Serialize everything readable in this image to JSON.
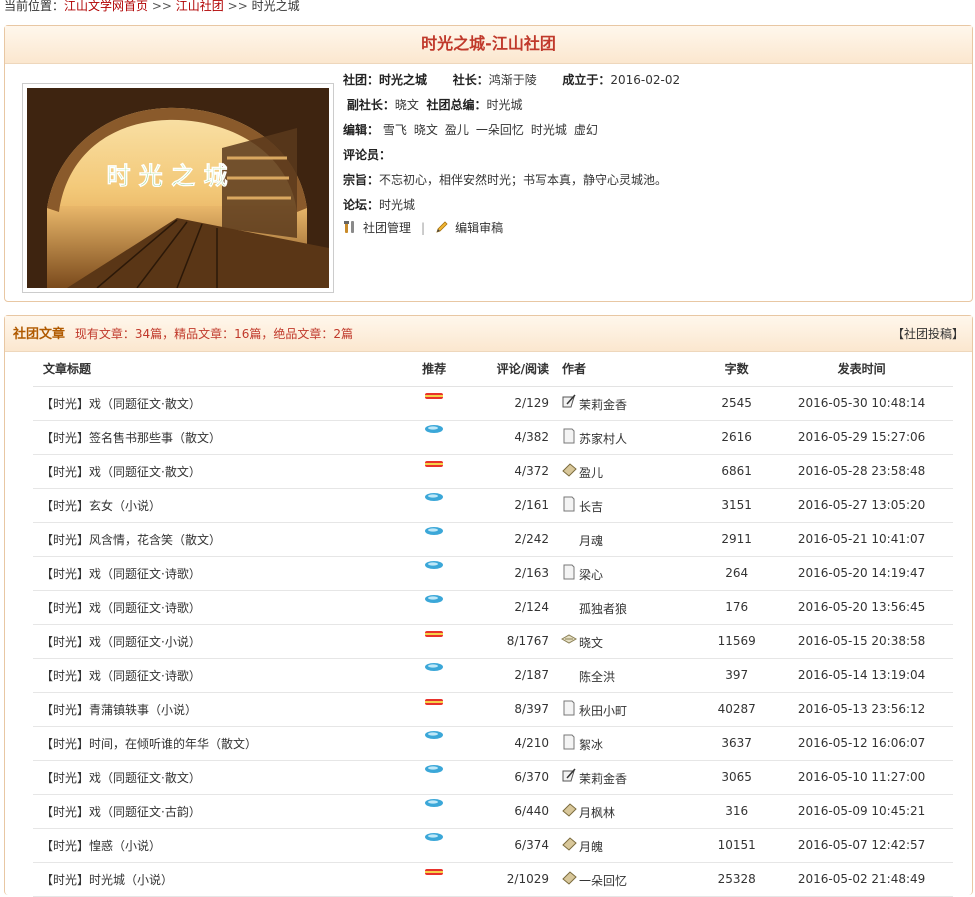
{
  "breadcrumb": {
    "prefix": "当前位置：",
    "home": "江山文学网首页",
    "sep": ">>",
    "section": "江山社团",
    "current": "时光之城"
  },
  "club": {
    "title": "时光之城-江山社团",
    "cover_text": "时 光 之 城",
    "club_label": "社团：",
    "club_name": "时光之城",
    "leader_label": "社长：",
    "leader": "鸿渐于陵",
    "founded_label": "成立于：",
    "founded": "2016-02-02",
    "vice_label": "副社长：",
    "vice": "晓文",
    "chief_label": "社团总编：",
    "chief": "时光城",
    "editors_label": "编辑：",
    "editors": [
      "雪飞",
      "晓文",
      "盈儿",
      "一朵回忆",
      "时光城",
      "虚幻"
    ],
    "reviewers_label": "评论员：",
    "motto_label": "宗旨：",
    "motto": "不忘初心，相伴安然时光；书写本真，静守心灵城池。",
    "forum_label": "论坛：",
    "forum": "时光城",
    "manage_label": "社团管理",
    "divider": "|",
    "review_label": "编辑审稿"
  },
  "articles": {
    "heading": "社团文章",
    "stats": "现有文章：34篇，精品文章：16篇，绝品文章：2篇",
    "submit": "【社团投稿】",
    "columns": {
      "title": "文章标题",
      "rec": "推荐",
      "counts": "评论/阅读",
      "author": "作者",
      "words": "字数",
      "time": "发表时间"
    },
    "rows": [
      {
        "title": "【时光】戏（同题征文·散文）",
        "rec": "red",
        "counts": "2/129",
        "author_icon": "quill",
        "author": "茉莉金香",
        "words": "2545",
        "time": "2016-05-30 10:48:14"
      },
      {
        "title": "【时光】签名售书那些事（散文）",
        "rec": "blue",
        "counts": "4/382",
        "author_icon": "page",
        "author": "苏家村人",
        "words": "2616",
        "time": "2016-05-29 15:27:06"
      },
      {
        "title": "【时光】戏（同题征文·散文）",
        "rec": "red",
        "counts": "4/372",
        "author_icon": "scroll",
        "author": "盈儿",
        "words": "6861",
        "time": "2016-05-28 23:58:48"
      },
      {
        "title": "【时光】玄女（小说）",
        "rec": "blue",
        "counts": "2/161",
        "author_icon": "page",
        "author": "长吉",
        "words": "3151",
        "time": "2016-05-27 13:05:20"
      },
      {
        "title": "【时光】风含情，花含笑（散文）",
        "rec": "blue",
        "counts": "2/242",
        "author_icon": "none",
        "author": "月魂",
        "words": "2911",
        "time": "2016-05-21 10:41:07"
      },
      {
        "title": "【时光】戏（同题征文·诗歌）",
        "rec": "blue",
        "counts": "2/163",
        "author_icon": "page",
        "author": "梁心",
        "words": "264",
        "time": "2016-05-20 14:19:47"
      },
      {
        "title": "【时光】戏（同题征文·诗歌）",
        "rec": "blue",
        "counts": "2/124",
        "author_icon": "none",
        "author": "孤独者狼",
        "words": "176",
        "time": "2016-05-20 13:56:45"
      },
      {
        "title": "【时光】戏（同题征文·小说）",
        "rec": "red",
        "counts": "8/1767",
        "author_icon": "scroll2",
        "author": "晓文",
        "words": "11569",
        "time": "2016-05-15 20:38:58"
      },
      {
        "title": "【时光】戏（同题征文·诗歌）",
        "rec": "blue",
        "counts": "2/187",
        "author_icon": "none",
        "author": "陈全洪",
        "words": "397",
        "time": "2016-05-14 13:19:04"
      },
      {
        "title": "【时光】青蒲镇轶事（小说）",
        "rec": "red",
        "counts": "8/397",
        "author_icon": "page",
        "author": "秋田小町",
        "words": "40287",
        "time": "2016-05-13 23:56:12"
      },
      {
        "title": "【时光】时间，在倾听谁的年华（散文）",
        "rec": "blue",
        "counts": "4/210",
        "author_icon": "page",
        "author": "絮冰",
        "words": "3637",
        "time": "2016-05-12 16:06:07"
      },
      {
        "title": "【时光】戏（同题征文·散文）",
        "rec": "blue",
        "counts": "6/370",
        "author_icon": "quill",
        "author": "茉莉金香",
        "words": "3065",
        "time": "2016-05-10 11:27:00"
      },
      {
        "title": "【时光】戏（同题征文·古韵）",
        "rec": "blue",
        "counts": "6/440",
        "author_icon": "scroll",
        "author": "月枫林",
        "words": "316",
        "time": "2016-05-09 10:45:21"
      },
      {
        "title": "【时光】惶惑（小说）",
        "rec": "blue",
        "counts": "6/374",
        "author_icon": "scroll",
        "author": "月魄",
        "words": "10151",
        "time": "2016-05-07 12:42:57"
      },
      {
        "title": "【时光】时光城（小说）",
        "rec": "red",
        "counts": "2/1029",
        "author_icon": "scroll",
        "author": "一朵回忆",
        "words": "25328",
        "time": "2016-05-02 21:48:49"
      }
    ]
  }
}
